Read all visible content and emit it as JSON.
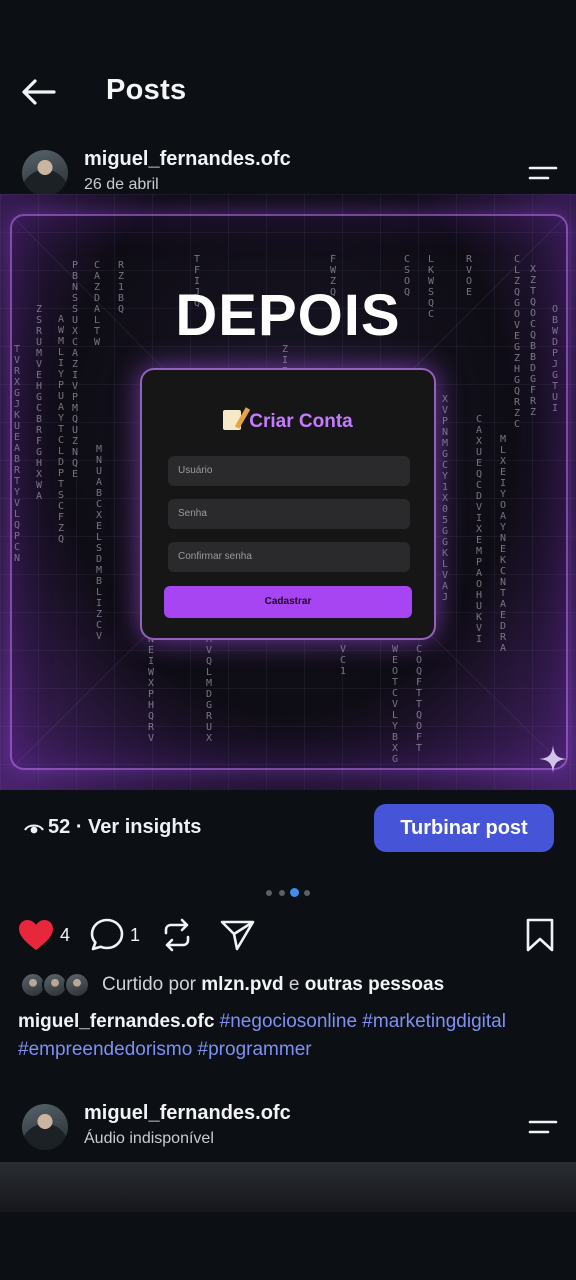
{
  "header": {
    "title": "Posts"
  },
  "post": {
    "username": "miguel_fernandes.ofc",
    "date": "26 de abril",
    "image": {
      "headline": "DEPOIS",
      "form_title": "Criar Conta",
      "fields": [
        "Usuário",
        "Senha",
        "Confirmar senha"
      ],
      "submit_label": "Cadastrar"
    },
    "insights": {
      "views": "52",
      "label": "· Ver insights"
    },
    "boost_label": "Turbinar post",
    "carousel": {
      "count": 4,
      "active": 3
    },
    "likes_count": "4",
    "comments_count": "1",
    "liked_by": {
      "prefix": "Curtido por",
      "user": "mlzn.pvd",
      "connector": "e",
      "others": "outras pessoas"
    },
    "caption": {
      "user": "miguel_fernandes.ofc",
      "hashtags": [
        "#negociosonline",
        "#marketingdigital",
        "#empreendedorismo",
        "#programmer"
      ]
    }
  },
  "next_post": {
    "username": "miguel_fernandes.ofc",
    "audio": "Áudio indisponível"
  },
  "colors": {
    "accent": "#4654d8",
    "like": "#e8263c",
    "hashtag": "#7f90f2",
    "neon": "#a845f2"
  },
  "icons": [
    "back-arrow-icon",
    "menu-icon",
    "eye-icon",
    "heart-icon",
    "comment-icon",
    "repost-icon",
    "send-icon",
    "bookmark-icon",
    "sparkle-icon"
  ]
}
